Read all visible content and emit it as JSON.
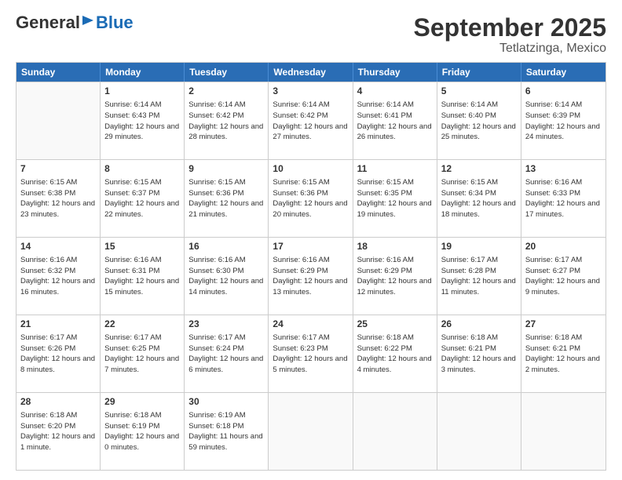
{
  "logo": {
    "general": "General",
    "blue": "Blue"
  },
  "title": {
    "month": "September 2025",
    "location": "Tetlatzinga, Mexico"
  },
  "header_days": [
    "Sunday",
    "Monday",
    "Tuesday",
    "Wednesday",
    "Thursday",
    "Friday",
    "Saturday"
  ],
  "weeks": [
    [
      {
        "day": "",
        "sunrise": "",
        "sunset": "",
        "daylight": ""
      },
      {
        "day": "1",
        "sunrise": "Sunrise: 6:14 AM",
        "sunset": "Sunset: 6:43 PM",
        "daylight": "Daylight: 12 hours and 29 minutes."
      },
      {
        "day": "2",
        "sunrise": "Sunrise: 6:14 AM",
        "sunset": "Sunset: 6:42 PM",
        "daylight": "Daylight: 12 hours and 28 minutes."
      },
      {
        "day": "3",
        "sunrise": "Sunrise: 6:14 AM",
        "sunset": "Sunset: 6:42 PM",
        "daylight": "Daylight: 12 hours and 27 minutes."
      },
      {
        "day": "4",
        "sunrise": "Sunrise: 6:14 AM",
        "sunset": "Sunset: 6:41 PM",
        "daylight": "Daylight: 12 hours and 26 minutes."
      },
      {
        "day": "5",
        "sunrise": "Sunrise: 6:14 AM",
        "sunset": "Sunset: 6:40 PM",
        "daylight": "Daylight: 12 hours and 25 minutes."
      },
      {
        "day": "6",
        "sunrise": "Sunrise: 6:14 AM",
        "sunset": "Sunset: 6:39 PM",
        "daylight": "Daylight: 12 hours and 24 minutes."
      }
    ],
    [
      {
        "day": "7",
        "sunrise": "Sunrise: 6:15 AM",
        "sunset": "Sunset: 6:38 PM",
        "daylight": "Daylight: 12 hours and 23 minutes."
      },
      {
        "day": "8",
        "sunrise": "Sunrise: 6:15 AM",
        "sunset": "Sunset: 6:37 PM",
        "daylight": "Daylight: 12 hours and 22 minutes."
      },
      {
        "day": "9",
        "sunrise": "Sunrise: 6:15 AM",
        "sunset": "Sunset: 6:36 PM",
        "daylight": "Daylight: 12 hours and 21 minutes."
      },
      {
        "day": "10",
        "sunrise": "Sunrise: 6:15 AM",
        "sunset": "Sunset: 6:36 PM",
        "daylight": "Daylight: 12 hours and 20 minutes."
      },
      {
        "day": "11",
        "sunrise": "Sunrise: 6:15 AM",
        "sunset": "Sunset: 6:35 PM",
        "daylight": "Daylight: 12 hours and 19 minutes."
      },
      {
        "day": "12",
        "sunrise": "Sunrise: 6:15 AM",
        "sunset": "Sunset: 6:34 PM",
        "daylight": "Daylight: 12 hours and 18 minutes."
      },
      {
        "day": "13",
        "sunrise": "Sunrise: 6:16 AM",
        "sunset": "Sunset: 6:33 PM",
        "daylight": "Daylight: 12 hours and 17 minutes."
      }
    ],
    [
      {
        "day": "14",
        "sunrise": "Sunrise: 6:16 AM",
        "sunset": "Sunset: 6:32 PM",
        "daylight": "Daylight: 12 hours and 16 minutes."
      },
      {
        "day": "15",
        "sunrise": "Sunrise: 6:16 AM",
        "sunset": "Sunset: 6:31 PM",
        "daylight": "Daylight: 12 hours and 15 minutes."
      },
      {
        "day": "16",
        "sunrise": "Sunrise: 6:16 AM",
        "sunset": "Sunset: 6:30 PM",
        "daylight": "Daylight: 12 hours and 14 minutes."
      },
      {
        "day": "17",
        "sunrise": "Sunrise: 6:16 AM",
        "sunset": "Sunset: 6:29 PM",
        "daylight": "Daylight: 12 hours and 13 minutes."
      },
      {
        "day": "18",
        "sunrise": "Sunrise: 6:16 AM",
        "sunset": "Sunset: 6:29 PM",
        "daylight": "Daylight: 12 hours and 12 minutes."
      },
      {
        "day": "19",
        "sunrise": "Sunrise: 6:17 AM",
        "sunset": "Sunset: 6:28 PM",
        "daylight": "Daylight: 12 hours and 11 minutes."
      },
      {
        "day": "20",
        "sunrise": "Sunrise: 6:17 AM",
        "sunset": "Sunset: 6:27 PM",
        "daylight": "Daylight: 12 hours and 9 minutes."
      }
    ],
    [
      {
        "day": "21",
        "sunrise": "Sunrise: 6:17 AM",
        "sunset": "Sunset: 6:26 PM",
        "daylight": "Daylight: 12 hours and 8 minutes."
      },
      {
        "day": "22",
        "sunrise": "Sunrise: 6:17 AM",
        "sunset": "Sunset: 6:25 PM",
        "daylight": "Daylight: 12 hours and 7 minutes."
      },
      {
        "day": "23",
        "sunrise": "Sunrise: 6:17 AM",
        "sunset": "Sunset: 6:24 PM",
        "daylight": "Daylight: 12 hours and 6 minutes."
      },
      {
        "day": "24",
        "sunrise": "Sunrise: 6:17 AM",
        "sunset": "Sunset: 6:23 PM",
        "daylight": "Daylight: 12 hours and 5 minutes."
      },
      {
        "day": "25",
        "sunrise": "Sunrise: 6:18 AM",
        "sunset": "Sunset: 6:22 PM",
        "daylight": "Daylight: 12 hours and 4 minutes."
      },
      {
        "day": "26",
        "sunrise": "Sunrise: 6:18 AM",
        "sunset": "Sunset: 6:21 PM",
        "daylight": "Daylight: 12 hours and 3 minutes."
      },
      {
        "day": "27",
        "sunrise": "Sunrise: 6:18 AM",
        "sunset": "Sunset: 6:21 PM",
        "daylight": "Daylight: 12 hours and 2 minutes."
      }
    ],
    [
      {
        "day": "28",
        "sunrise": "Sunrise: 6:18 AM",
        "sunset": "Sunset: 6:20 PM",
        "daylight": "Daylight: 12 hours and 1 minute."
      },
      {
        "day": "29",
        "sunrise": "Sunrise: 6:18 AM",
        "sunset": "Sunset: 6:19 PM",
        "daylight": "Daylight: 12 hours and 0 minutes."
      },
      {
        "day": "30",
        "sunrise": "Sunrise: 6:19 AM",
        "sunset": "Sunset: 6:18 PM",
        "daylight": "Daylight: 11 hours and 59 minutes."
      },
      {
        "day": "",
        "sunrise": "",
        "sunset": "",
        "daylight": ""
      },
      {
        "day": "",
        "sunrise": "",
        "sunset": "",
        "daylight": ""
      },
      {
        "day": "",
        "sunrise": "",
        "sunset": "",
        "daylight": ""
      },
      {
        "day": "",
        "sunrise": "",
        "sunset": "",
        "daylight": ""
      }
    ]
  ]
}
